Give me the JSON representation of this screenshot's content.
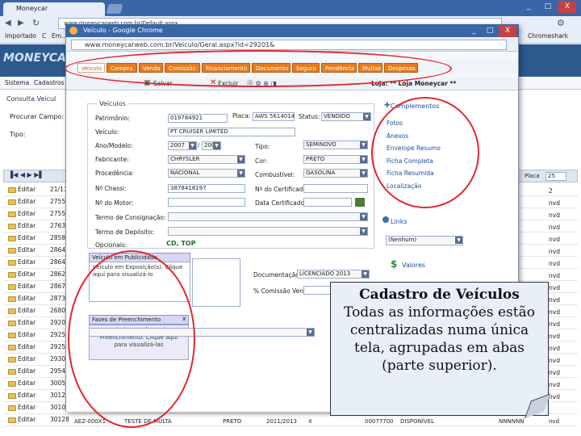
{
  "outer_browser": {
    "tab_title": "Moneycar",
    "url": "www.moneycarweb.com.br/Default.aspx",
    "bookmarks": [
      "Importado",
      "C",
      "Em..."
    ],
    "bookmark_right": "Chromeshark",
    "window_controls": [
      "_",
      "□",
      "X"
    ]
  },
  "app": {
    "logo": "MONEYCA",
    "menu": [
      "Sistema",
      "Cadastros"
    ],
    "consulta_title": "Consulta Veícul",
    "filter_labels": [
      "Procurar Campo:",
      "Tipo:"
    ],
    "grid_page_size": "25",
    "grid_rows": [
      {
        "label": "Editar",
        "num": "21/17"
      },
      {
        "label": "Editar",
        "num": "27557"
      },
      {
        "label": "Editar",
        "num": "27557"
      },
      {
        "label": "Editar",
        "num": "27637"
      },
      {
        "label": "Editar",
        "num": "28581"
      },
      {
        "label": "Editar",
        "num": "28640"
      },
      {
        "label": "Editar",
        "num": "28641"
      },
      {
        "label": "Editar",
        "num": "28620"
      },
      {
        "label": "Editar",
        "num": "28670"
      },
      {
        "label": "Editar",
        "num": "28730"
      },
      {
        "label": "Editar",
        "num": "26801"
      },
      {
        "label": "Editar",
        "num": "29200"
      },
      {
        "label": "Editar",
        "num": "29251"
      },
      {
        "label": "Editar",
        "num": "29257"
      },
      {
        "label": "Editar",
        "num": "29304"
      },
      {
        "label": "Editar",
        "num": "29542"
      },
      {
        "label": "Editar",
        "num": "30050"
      },
      {
        "label": "Editar",
        "num": "30122"
      },
      {
        "label": "Editar",
        "num": "30109"
      },
      {
        "label": "Editar",
        "num": "30128"
      }
    ],
    "bottom_row": {
      "id": "AEZ-000X1",
      "desc": "TESTE DE MULTA",
      "cor": "PRETO",
      "ano": "2011/2013",
      "x": "X",
      "val": "00077700",
      "status": "DISPONÍVEL",
      "nr": "NNNNNN",
      "end": "nvd"
    },
    "right_col_head": "Placa",
    "right_col_values": [
      "2",
      "nvd",
      "nvd",
      "nvd",
      "nvd",
      "nvd",
      "nvd",
      "nvd",
      "nvd",
      "nvd",
      "nvd",
      "nvd",
      "nvd",
      "nvd",
      "nvd",
      "nvd",
      "nvd",
      "nvd"
    ]
  },
  "popup": {
    "title": "Veículo - Google Chrome",
    "url": "www.moneycarweb.com.br/Veiculo/Geral.aspx?id=29201&",
    "tabs": [
      "Veículo",
      "Compra",
      "Venda",
      "Comissão",
      "Financiamento",
      "Documento",
      "Seguro",
      "Pendência",
      "Multas",
      "Despesas"
    ],
    "buttons": [
      "Salvar",
      "Excluir"
    ],
    "loja": "Loja: ** Loja Moneycar **",
    "veiculos_title": "Veículos",
    "fields": {
      "patrimonio_label": "Patrimônio:",
      "patrimonio": "019784921",
      "placa_label": "Placa:",
      "placa": "AWS 5614014",
      "status_label": "Status:",
      "status": "VENDIDO",
      "veiculo_label": "Veículo:",
      "veiculo": "PT CRUISER LIMITED",
      "anomodelo_label": "Ano/Modelo:",
      "ano": "2007",
      "modelo": "2007",
      "tipo_label": "Tipo:",
      "tipo": "SEMINOVO",
      "fabricante_label": "Fabricante:",
      "fabricante": "CHRYSLER",
      "cor_label": "Cor:",
      "cor": "PRETO",
      "procedencia_label": "Procedência:",
      "procedencia": "NACIONAL",
      "combustivel_label": "Combustível:",
      "combustivel": "GASOLINA",
      "chassi_label": "Nº Chassi:",
      "chassi": "3878418197",
      "certificado_label": "Nº do Certificado:",
      "motor_label": "Nº do Motor:",
      "data_cert_label": "Data Certificado:",
      "termo_label": "Termo de Consignação:",
      "termo_deposito_label": "Termo de Depósito:",
      "opcionais_label": "Opcionais:",
      "opcionais_val": "CD, TOP"
    },
    "publicidade_title": "Veículo em Publicidade",
    "publicidade_text": "Veículo em Exposição(s). Clique aqui para visualizá-lo",
    "fase_title": "Fases de Preenchimento",
    "fase_text": "Veículo com fases de Preenchimento. Clique aqui para visualizá-las",
    "documentacao_label": "Documentação:",
    "documentacao": "LICENCIADO 2013",
    "comissao_label": "% Comissão Venda:",
    "right_panel": {
      "complementos": "Complementos",
      "links": [
        "Fotos",
        "Anexos",
        "Envelope Resumo",
        "Ficha Completa",
        "Ficha Resumida",
        "Localização"
      ],
      "links_title": "Links",
      "links_select": "(Nenhum)",
      "valores_title": "Valores"
    }
  },
  "note": "Cadastro de Veículos Todas as informações estão centralizadas numa única tela, agrupadas em abas (parte superior).",
  "note_title": "Cadastro de Veículos",
  "note_body": "Todas as informações estão centralizadas numa única tela, agrupadas em abas (parte superior)."
}
